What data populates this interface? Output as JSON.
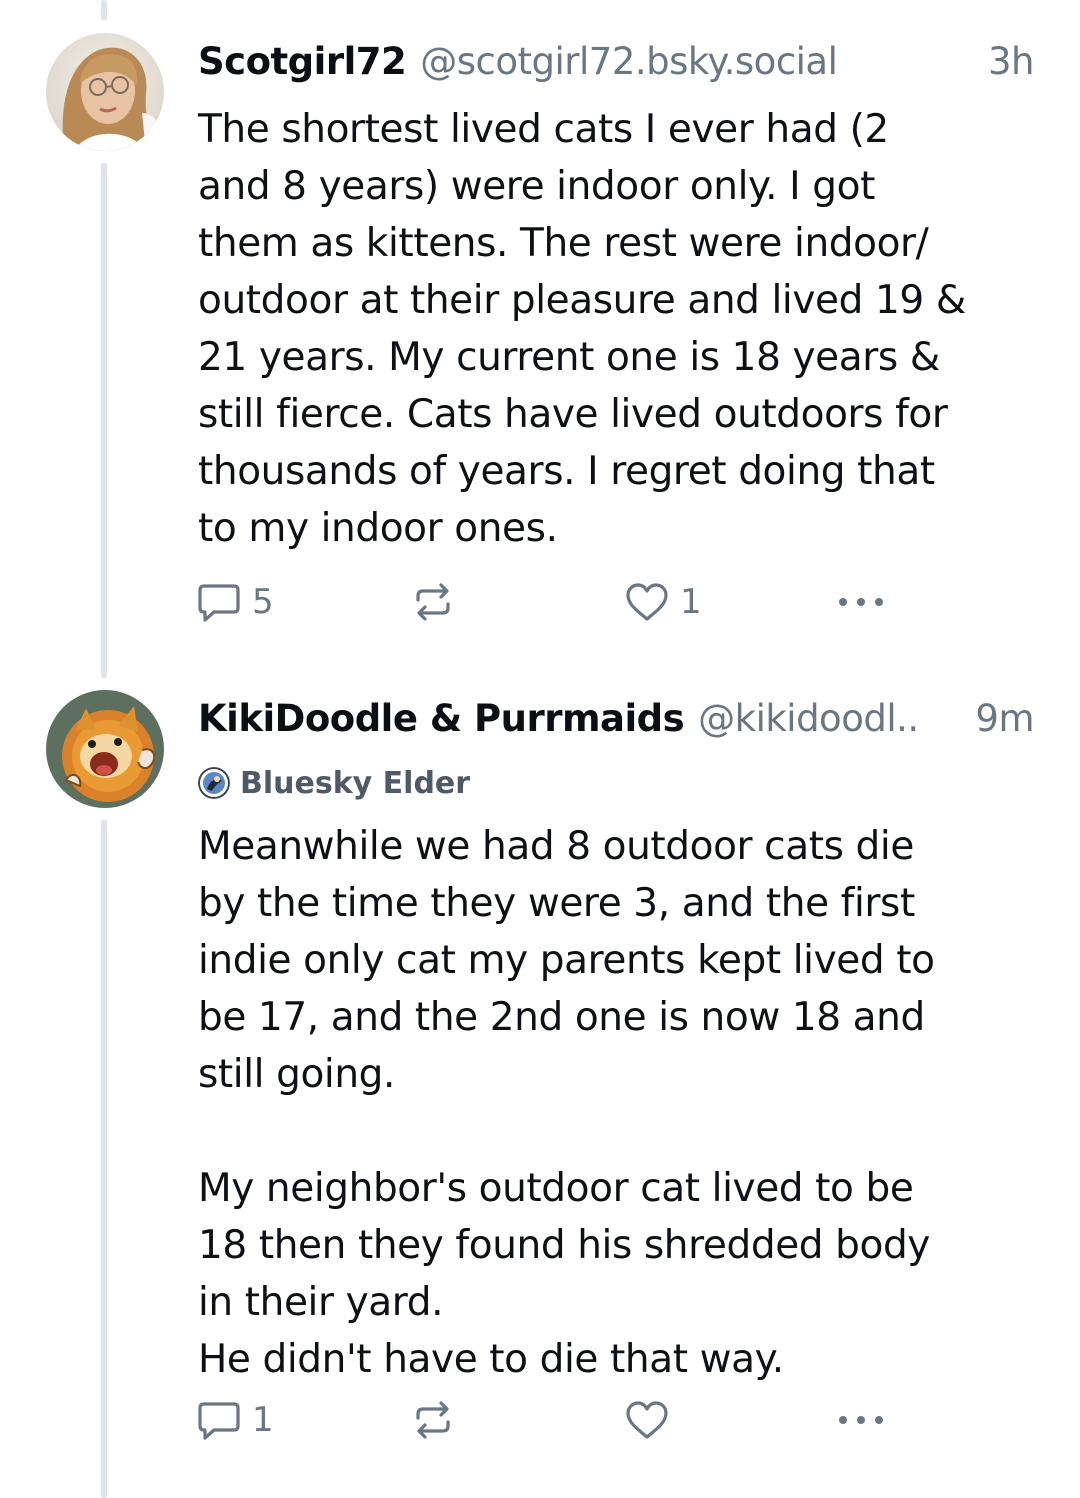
{
  "posts": [
    {
      "display_name": "Scotgirl72",
      "handle": "@scotgirl72.bsky.social",
      "time": "3h",
      "text": "The shortest lived cats I ever had (2\nand 8 years) were indoor only. I got\nthem as kittens. The rest were indoor/\noutdoor at their pleasure and lived 19 &\n21 years. My current one is 18 years &\nstill fierce. Cats have lived outdoors for\nthousands of years. I regret doing that\nto my indoor ones.",
      "reply_count": "5",
      "repost_count": "",
      "like_count": "1",
      "avatar_icon": "woman-with-glasses-photo"
    },
    {
      "display_name": "KikiDoodle & Purrmaids",
      "handle": "@kikidoodl..",
      "time": "9m",
      "badge": "Bluesky Elder",
      "text": "Meanwhile we had 8 outdoor cats die\nby the time they were 3, and the first\nindie only cat my parents kept lived to\nbe 17, and the 2nd one is now 18 and\nstill going.\n\nMy neighbor's outdoor cat lived to be\n18 then they found his shredded body\nin their yard.\nHe didn't have to die that way.",
      "reply_count": "1",
      "repost_count": "",
      "like_count": "",
      "avatar_icon": "cartoon-lion-cat-illustration"
    }
  ],
  "icons": {
    "reply": "speech-bubble-icon",
    "repost": "repost-arrows-icon",
    "like": "heart-icon",
    "more": "more-dots-icon"
  },
  "colors": {
    "text": "#0d1116",
    "muted": "#6a7682",
    "thread_line": "#dfe4ea",
    "background": "#ffffff"
  }
}
